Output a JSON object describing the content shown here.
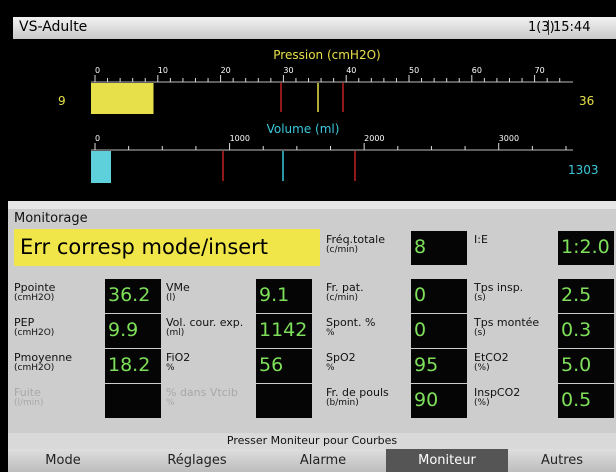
{
  "header": {
    "title": "VS-Adulte",
    "page": "1(3)",
    "time": "15:44"
  },
  "pressure": {
    "label": "Pression (cmH2O)",
    "min_value": "9",
    "max_value": "36",
    "scale": [
      "0",
      "10",
      "20",
      "30",
      "40",
      "50",
      "60",
      "70"
    ],
    "color": "#e8e04a"
  },
  "volume": {
    "label": "Volume (ml)",
    "max_value": "1303",
    "scale": [
      "0",
      "1000",
      "2000",
      "3000"
    ],
    "color": "#3cc8dc"
  },
  "monitor": {
    "title": "Monitorage",
    "alarm": "Err corresp mode/insert",
    "params": [
      {
        "label": "Fréq.totale",
        "unit": "(c/min)",
        "value": "8"
      },
      {
        "label": "I:E",
        "unit": "",
        "value": "1:2.0"
      },
      {
        "label": "Ppointe",
        "unit": "(cmH2O)",
        "value": "36.2"
      },
      {
        "label": "VMe",
        "unit": "(l)",
        "value": "9.1"
      },
      {
        "label": "Fr. pat.",
        "unit": "(c/min)",
        "value": "0"
      },
      {
        "label": "Tps insp.",
        "unit": "(s)",
        "value": "2.5"
      },
      {
        "label": "PEP",
        "unit": "(cmH2O)",
        "value": "9.9"
      },
      {
        "label": "Vol. cour. exp.",
        "unit": "(ml)",
        "value": "1142"
      },
      {
        "label": "Spont. %",
        "unit": "%",
        "value": "0"
      },
      {
        "label": "Tps montée",
        "unit": "(s)",
        "value": "0.3"
      },
      {
        "label": "Pmoyenne",
        "unit": "(cmH2O)",
        "value": "18.2"
      },
      {
        "label": "FiO2",
        "unit": "%",
        "value": "56"
      },
      {
        "label": "SpO2",
        "unit": "%",
        "value": "95"
      },
      {
        "label": "EtCO2",
        "unit": "(%)",
        "value": "5.0"
      },
      {
        "label": "Fuite",
        "unit": "(l/min)",
        "value": ""
      },
      {
        "label": "% dans Vtcib",
        "unit": "%",
        "value": ""
      },
      {
        "label": "Fr. de pouls",
        "unit": "(b/min)",
        "value": "90"
      },
      {
        "label": "InspCO2",
        "unit": "(%)",
        "value": "0.5"
      }
    ]
  },
  "hint": "Presser Moniteur pour Courbes",
  "tabs": [
    "Mode",
    "Réglages",
    "Alarme",
    "Moniteur",
    "Autres"
  ]
}
